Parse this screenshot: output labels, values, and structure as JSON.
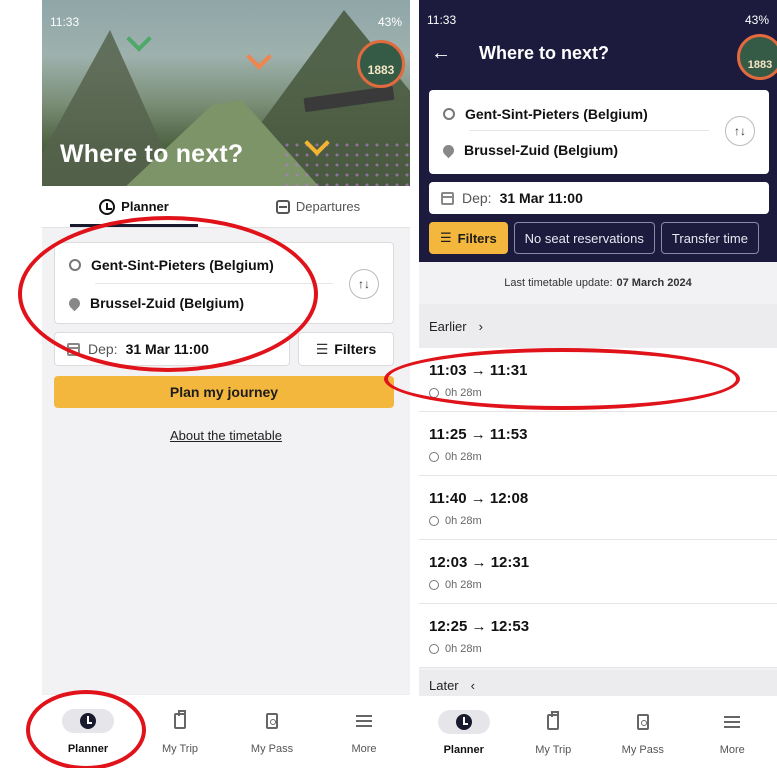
{
  "left": {
    "status": {
      "time": "11:33",
      "battery": "43%"
    },
    "hero_title": "Where to next?",
    "badge": "1883",
    "tabs": [
      {
        "label": "Planner",
        "icon": "clock-icon"
      },
      {
        "label": "Departures",
        "icon": "train-icon"
      }
    ],
    "route": {
      "from": "Gent-Sint-Pieters (Belgium)",
      "to": "Brussel-Zuid (Belgium)",
      "swap_symbol": "↑↓"
    },
    "departure": {
      "prefix": "Dep:",
      "value": "31 Mar 11:00"
    },
    "filters_label": "Filters",
    "plan_button": "Plan my journey",
    "about_link": "About the timetable"
  },
  "right": {
    "status": {
      "time": "11:33",
      "battery": "43%"
    },
    "title": "Where to next?",
    "badge": "1883",
    "route": {
      "from": "Gent-Sint-Pieters (Belgium)",
      "to": "Brussel-Zuid (Belgium)",
      "swap_symbol": "↑↓"
    },
    "departure": {
      "prefix": "Dep:",
      "value": "31 Mar 11:00"
    },
    "chips": [
      "Filters",
      "No seat reservations",
      "Transfer time"
    ],
    "update": {
      "label": "Last timetable update:",
      "date": "07 March 2024"
    },
    "earlier": "Earlier",
    "later": "Later",
    "trips": [
      {
        "times": "11:03 → 11:31",
        "duration": "0h 28m"
      },
      {
        "times": "11:25 → 11:53",
        "duration": "0h 28m"
      },
      {
        "times": "11:40 → 12:08",
        "duration": "0h 28m"
      },
      {
        "times": "12:03 → 12:31",
        "duration": "0h 28m"
      },
      {
        "times": "12:25 → 12:53",
        "duration": "0h 28m"
      }
    ]
  },
  "nav": [
    {
      "label": "Planner",
      "icon": "clock-icon"
    },
    {
      "label": "My Trip",
      "icon": "luggage-icon"
    },
    {
      "label": "My Pass",
      "icon": "pass-icon"
    },
    {
      "label": "More",
      "icon": "menu-icon"
    }
  ],
  "colors": {
    "navy": "#1c1b3d",
    "accent": "#f4b73d",
    "annotation": "#e0131b"
  }
}
